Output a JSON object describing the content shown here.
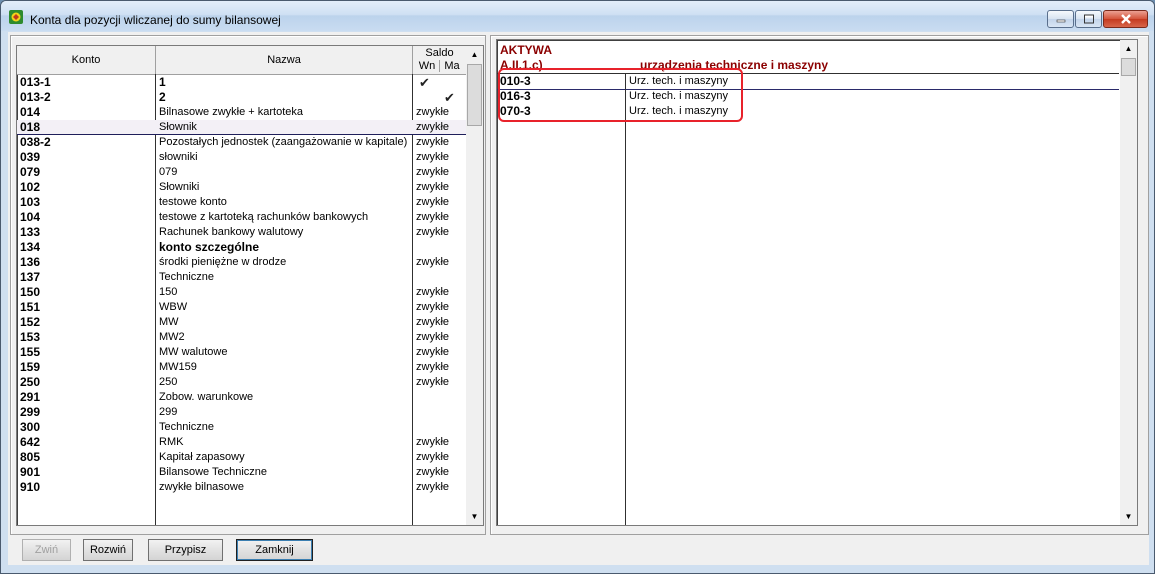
{
  "window": {
    "title": "Konta dla pozycji wliczanej do sumy bilansowej"
  },
  "left_table": {
    "headers": {
      "konto": "Konto",
      "nazwa": "Nazwa",
      "saldo": "Saldo",
      "wn": "Wn",
      "ma": "Ma"
    },
    "rows": [
      {
        "konto": "013-1",
        "nazwa": "1",
        "saldo": "",
        "bold_name": true,
        "check": "wn"
      },
      {
        "konto": "013-2",
        "nazwa": "2",
        "saldo": "",
        "bold_name": true,
        "check": "ma"
      },
      {
        "konto": "014",
        "nazwa": "Bilnasowe zwykłe + kartoteka",
        "saldo": "zwykłe"
      },
      {
        "konto": "018",
        "nazwa": "Słownik",
        "saldo": "zwykłe",
        "selected": true
      },
      {
        "konto": "038-2",
        "nazwa": "Pozostałych jednostek (zaangażowanie w kapitale)",
        "saldo": "zwykłe"
      },
      {
        "konto": "039",
        "nazwa": "słowniki",
        "saldo": "zwykłe"
      },
      {
        "konto": "079",
        "nazwa": "079",
        "saldo": "zwykłe"
      },
      {
        "konto": "102",
        "nazwa": "Słowniki",
        "saldo": "zwykłe"
      },
      {
        "konto": "103",
        "nazwa": "testowe konto",
        "saldo": "zwykłe"
      },
      {
        "konto": "104",
        "nazwa": "testowe z kartoteką rachunków bankowych",
        "saldo": "zwykłe"
      },
      {
        "konto": "133",
        "nazwa": "Rachunek bankowy walutowy",
        "saldo": "zwykłe"
      },
      {
        "konto": "134",
        "nazwa": "konto szczególne",
        "saldo": "",
        "bold_name": true
      },
      {
        "konto": "136",
        "nazwa": "środki pieniężne w drodze",
        "saldo": "zwykłe"
      },
      {
        "konto": "137",
        "nazwa": "Techniczne",
        "saldo": ""
      },
      {
        "konto": "150",
        "nazwa": "150",
        "saldo": "zwykłe"
      },
      {
        "konto": "151",
        "nazwa": "WBW",
        "saldo": "zwykłe"
      },
      {
        "konto": "152",
        "nazwa": "MW",
        "saldo": "zwykłe"
      },
      {
        "konto": "153",
        "nazwa": "MW2",
        "saldo": "zwykłe"
      },
      {
        "konto": "155",
        "nazwa": "MW walutowe",
        "saldo": "zwykłe"
      },
      {
        "konto": "159",
        "nazwa": "MW159",
        "saldo": "zwykłe"
      },
      {
        "konto": "250",
        "nazwa": "250",
        "saldo": "zwykłe"
      },
      {
        "konto": "291",
        "nazwa": "Zobow. warunkowe",
        "saldo": ""
      },
      {
        "konto": "299",
        "nazwa": "299",
        "saldo": ""
      },
      {
        "konto": "300",
        "nazwa": "Techniczne",
        "saldo": ""
      },
      {
        "konto": "642",
        "nazwa": "RMK",
        "saldo": "zwykłe"
      },
      {
        "konto": "805",
        "nazwa": "Kapitał zapasowy",
        "saldo": "zwykłe"
      },
      {
        "konto": "901",
        "nazwa": "Bilansowe Techniczne",
        "saldo": "zwykłe"
      },
      {
        "konto": "910",
        "nazwa": "zwykłe bilnasowe",
        "saldo": "zwykłe"
      }
    ]
  },
  "right_panel": {
    "header_line1": "AKTYWA",
    "header_code": "A.II.1.c)",
    "header_name": "urządzenia techniczne i maszyny",
    "rows": [
      {
        "konto": "010-3",
        "nazwa": "Urz. tech. i maszyny"
      },
      {
        "konto": "016-3",
        "nazwa": "Urz. tech. i maszyny"
      },
      {
        "konto": "070-3",
        "nazwa": "Urz. tech. i maszyny"
      }
    ]
  },
  "buttons": {
    "zwin": "Zwiń",
    "rozwin": "Rozwiń",
    "przypisz": "Przypisz",
    "zamknij": "Zamknij"
  },
  "colors": {
    "accent_red_text": "#8b0000",
    "highlight_box": "#e8222b",
    "selection_row": "#f3f0f6"
  },
  "icons": {
    "app": "app-logo-icon",
    "minimize": "minimize-icon",
    "maximize": "maximize-icon",
    "close": "close-icon",
    "check": "checkmark-icon"
  }
}
